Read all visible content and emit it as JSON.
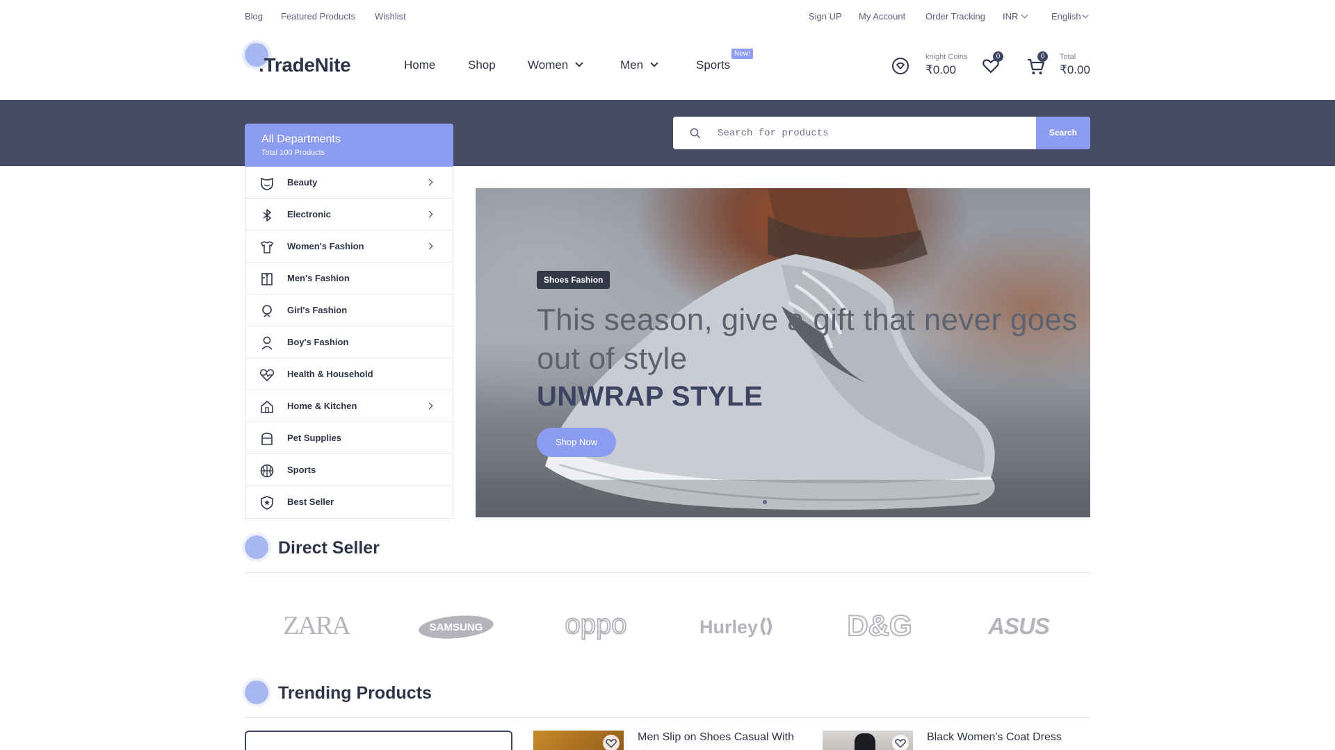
{
  "topbar": {
    "left_links": [
      "Blog",
      "Featured Products",
      "Wishlist"
    ],
    "right_links": [
      "Sign UP",
      "My Account",
      "Order Tracking"
    ],
    "currency": "INR",
    "language": "English"
  },
  "header": {
    "logo": ".TradeNite",
    "nav": {
      "home": "Home",
      "shop": "Shop",
      "women": "Women",
      "men": "Men",
      "sports": "Sports",
      "new_badge": "New!"
    },
    "coins_label": "knight Coins",
    "coins_value": "₹0.00",
    "wishlist_count": "0",
    "cart_count": "0",
    "total_label": "Total",
    "total_value": "₹0.00"
  },
  "search": {
    "placeholder": "Search for products",
    "button": "Search"
  },
  "departments": {
    "title": "All Departments",
    "subtitle": "Total 100 Products",
    "items": [
      {
        "label": "Beauty",
        "icon": "beauty-icon"
      },
      {
        "label": "Electronic",
        "icon": "bluetooth-icon"
      },
      {
        "label": "Women's Fashion",
        "icon": "womens-fashion-icon"
      },
      {
        "label": "Men's Fashion",
        "icon": "mens-fashion-icon"
      },
      {
        "label": "Girl's Fashion",
        "icon": "girls-fashion-icon"
      },
      {
        "label": "Boy's Fashion",
        "icon": "boys-fashion-icon"
      },
      {
        "label": "Health & Household",
        "icon": "heart-pulse-icon"
      },
      {
        "label": "Home & Kitchen",
        "icon": "home-icon"
      },
      {
        "label": "Pet Supplies",
        "icon": "pet-supplies-icon"
      },
      {
        "label": "Sports",
        "icon": "basketball-icon"
      },
      {
        "label": "Best Seller",
        "icon": "shield-star-icon"
      }
    ]
  },
  "hero": {
    "tag": "Shoes Fashion",
    "line1": "This season, give a gift that never goes",
    "line2": "out of style",
    "title": "UNWRAP STYLE",
    "button": "Shop Now"
  },
  "sections": {
    "direct_seller": "Direct Seller",
    "trending": "Trending Products"
  },
  "brands": [
    "ZARA",
    "SAMSUNG",
    "oppo",
    "Hurley",
    "D&G",
    "ASUS"
  ],
  "products": [
    {
      "name": "Men Slip on Shoes Casual With"
    },
    {
      "name": "Black Women's Coat Dress"
    }
  ],
  "colors": {
    "accent": "#8c9cf0",
    "dark_band": "#454d66",
    "text_dark": "#2f3547"
  }
}
